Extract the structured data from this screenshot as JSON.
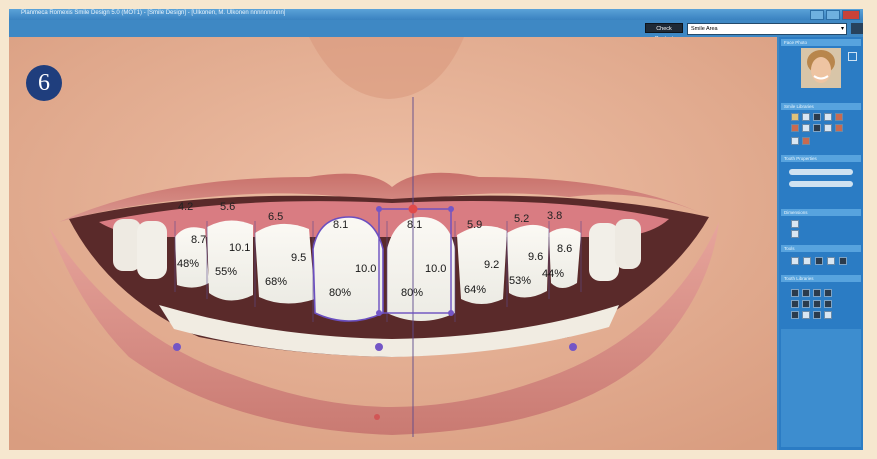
{
  "window": {
    "title": "Planmeca Romexis Smile Design 5.0 (MOT1) - [Smile Design] - [Ulkonen, M. Ulkonen nnnnnnnnnn]"
  },
  "toolbar": {
    "check_contact_label": "Check Contact",
    "mode_value": "Smile Area"
  },
  "step_badge": "6",
  "measurements": {
    "widths": [
      "4.2",
      "5.6",
      "6.5",
      "8.1",
      "8.1",
      "5.9",
      "5.2",
      "3.8"
    ],
    "heights": [
      "8.7",
      "10.1",
      "9.5",
      "10.0",
      "10.0",
      "9.2",
      "9.6",
      "8.6"
    ],
    "percents": [
      "48%",
      "55%",
      "68%",
      "80%",
      "80%",
      "64%",
      "53%",
      "44%"
    ]
  },
  "panel": {
    "sections": [
      {
        "label": "Face Photo"
      },
      {
        "label": "Smile Libraries"
      },
      {
        "label": "Tooth Properties"
      },
      {
        "label": "Dimensions"
      },
      {
        "label": "Tools"
      },
      {
        "label": "Tooth Libraries"
      }
    ]
  },
  "colors": {
    "frame_blue": "#3e87c2",
    "panel_blue": "#2b7cc4",
    "badge_navy": "#1f3e7d",
    "guide_purple": "#7456c6"
  }
}
